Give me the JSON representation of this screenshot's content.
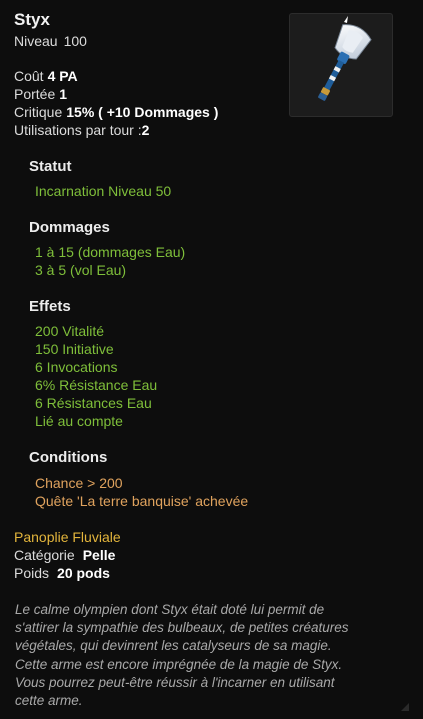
{
  "item": {
    "name": "Styx",
    "level_label": "Niveau",
    "level_value": "100"
  },
  "stats": {
    "cost_label": "Coût",
    "cost_value": "4 PA",
    "range_label": "Portée",
    "range_value": "1",
    "crit_label": "Critique",
    "crit_value": "15% ( +10 Dommages )",
    "uses_label": "Utilisations par tour :",
    "uses_value": "2"
  },
  "sections": {
    "status": {
      "title": "Statut",
      "lines": [
        "Incarnation Niveau 50"
      ]
    },
    "damage": {
      "title": "Dommages",
      "lines": [
        "1 à 15 (dommages Eau)",
        "3 à 5 (vol Eau)"
      ]
    },
    "effects": {
      "title": "Effets",
      "lines": [
        "200 Vitalité",
        "150 Initiative",
        "6 Invocations",
        "6% Résistance Eau",
        "6 Résistances Eau",
        "Lié au compte"
      ]
    },
    "conditions": {
      "title": "Conditions",
      "lines": [
        "Chance > 200",
        "Quête 'La terre banquise' achevée"
      ]
    }
  },
  "details": {
    "panoply": "Panoplie Fluviale",
    "category_label": "Catégorie",
    "category_value": "Pelle",
    "weight_label": "Poids",
    "weight_value": "20 pods"
  },
  "description": {
    "lines": [
      "Le calme olympien dont Styx était doté lui permit de",
      "s'attirer la sympathie des bulbeaux, de petites créatures",
      "végétales, qui devinrent les catalyseurs de sa magie.",
      "Cette arme est encore imprégnée de la magie de Styx.",
      "Vous pourrez peut-être réussir à l'incarner en utilisant",
      "cette arme."
    ]
  },
  "colors": {
    "effect_text": "#7fbf3a",
    "condition_text": "#e0a35e",
    "panoply_text": "#e3b53c"
  },
  "icons": {
    "item_image": "shovel-weapon-icon"
  }
}
